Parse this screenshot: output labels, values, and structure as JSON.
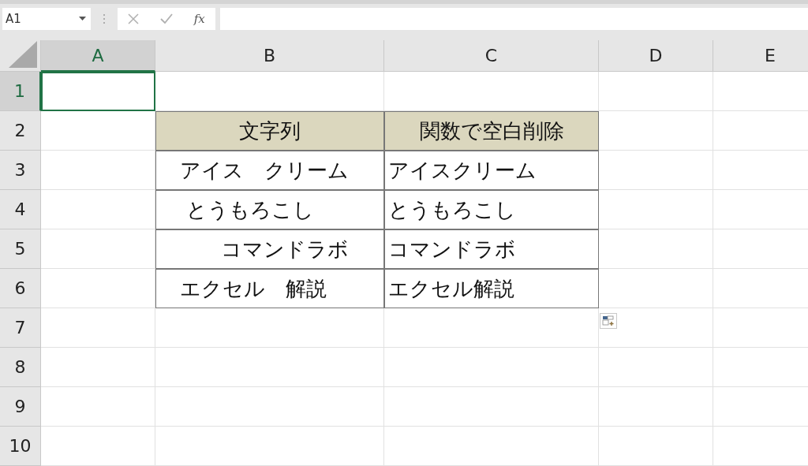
{
  "name_box": {
    "value": "A1"
  },
  "formula_bar": {
    "function_label": "fx"
  },
  "columns": [
    {
      "label": "A",
      "selected": true
    },
    {
      "label": "B",
      "selected": false
    },
    {
      "label": "C",
      "selected": false
    },
    {
      "label": "D",
      "selected": false
    },
    {
      "label": "E",
      "selected": false
    }
  ],
  "rows": [
    {
      "label": "1",
      "selected": true
    },
    {
      "label": "2",
      "selected": false
    },
    {
      "label": "3",
      "selected": false
    },
    {
      "label": "4",
      "selected": false
    },
    {
      "label": "5",
      "selected": false
    },
    {
      "label": "6",
      "selected": false
    },
    {
      "label": "7",
      "selected": false
    },
    {
      "label": "8",
      "selected": false
    },
    {
      "label": "9",
      "selected": false
    },
    {
      "label": "10",
      "selected": false
    }
  ],
  "table": {
    "header": [
      "文字列",
      "関数で空白削除"
    ],
    "rows": [
      [
        "　アイス　クリーム",
        "アイスクリーム"
      ],
      [
        "　 とうもろこし",
        "とうもろこし"
      ],
      [
        "　　　コマンドラボ",
        "コマンドラボ"
      ],
      [
        "　エクセル　解説",
        "エクセル解説"
      ]
    ]
  }
}
